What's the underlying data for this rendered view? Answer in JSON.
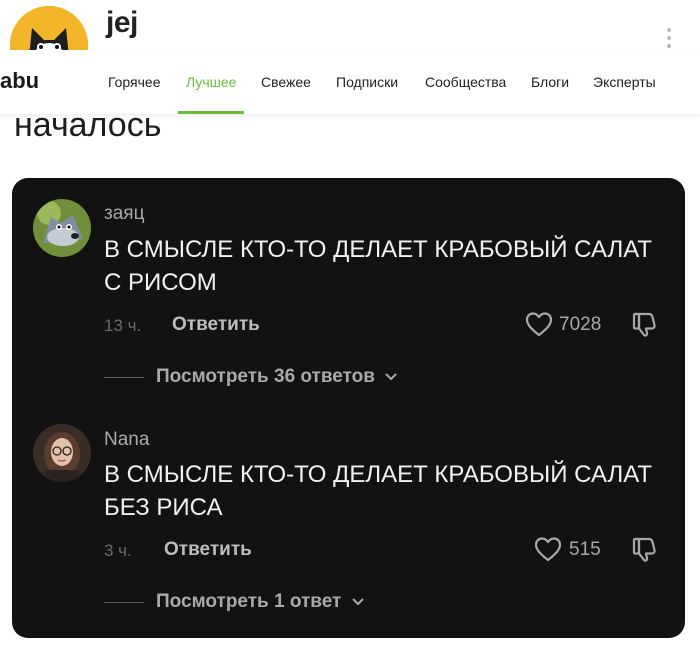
{
  "post": {
    "author": "jej",
    "body_text": "началось"
  },
  "nav": {
    "logo": "abu",
    "tabs": [
      {
        "label": "Горячее"
      },
      {
        "label": "Лучшее",
        "active": true
      },
      {
        "label": "Свежее"
      },
      {
        "label": "Подписки"
      },
      {
        "label": "Сообщества"
      },
      {
        "label": "Блоги"
      },
      {
        "label": "Эксперты"
      }
    ],
    "accent_color": "#6bbf3a"
  },
  "comments": [
    {
      "name": "заяц",
      "text": "В СМЫСЛЕ КТО-ТО ДЕЛАЕТ КРАБОВЫЙ САЛАТ С РИСОМ",
      "time": "13 ч.",
      "reply_label": "Ответить",
      "likes": "7028",
      "view_replies": "Посмотреть 36 ответов"
    },
    {
      "name": "Nana",
      "text": "В СМЫСЛЕ КТО-ТО ДЕЛАЕТ КРАБОВЫЙ САЛАТ БЕЗ РИСА",
      "time": "3 ч.",
      "reply_label": "Ответить",
      "likes": "515",
      "view_replies": "Посмотреть 1 ответ"
    }
  ],
  "icons": [
    "cat-avatar-icon",
    "kebab-menu-icon",
    "heart-icon",
    "dislike-icon",
    "chevron-down-icon"
  ]
}
